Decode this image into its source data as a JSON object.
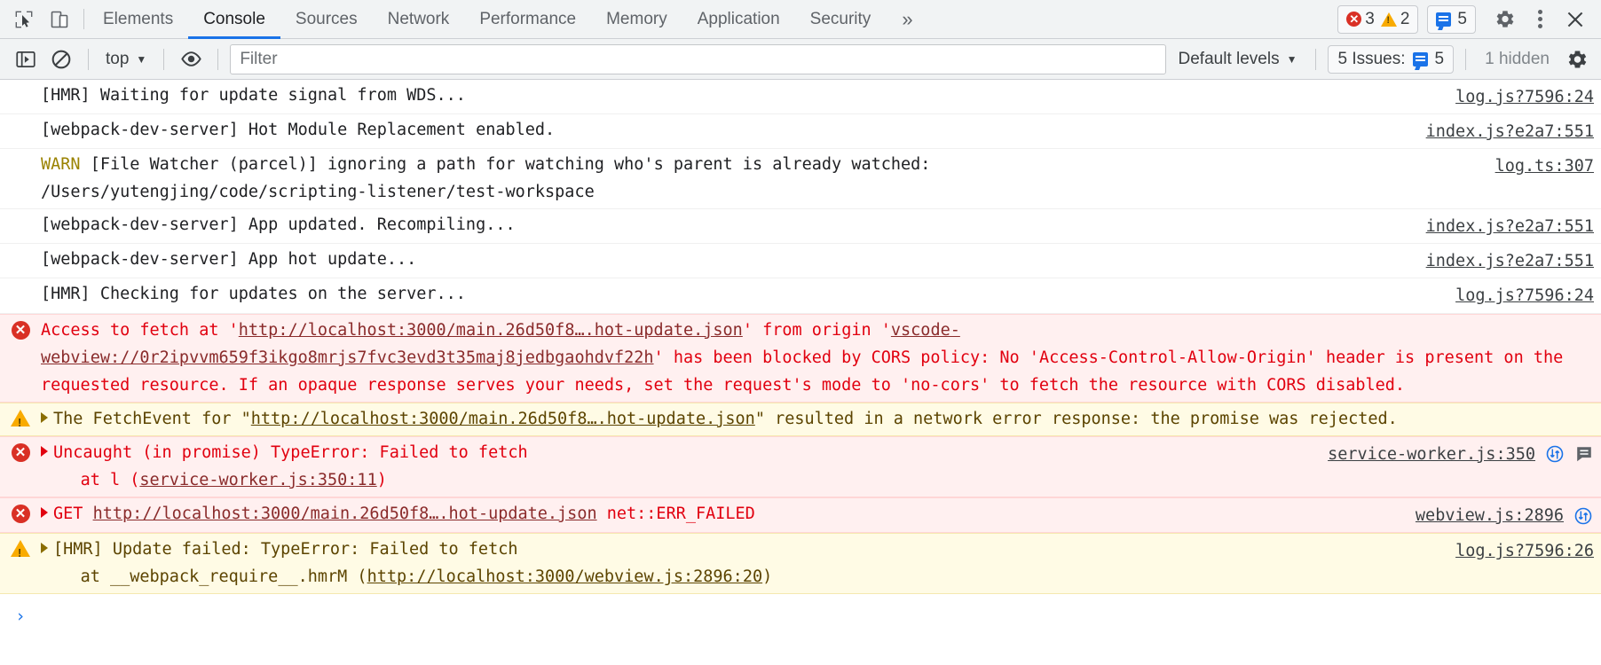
{
  "tabbar": {
    "left_icons": [
      {
        "name": "inspect-element-icon",
        "label": "Inspect element"
      },
      {
        "name": "device-toolbar-icon",
        "label": "Toggle device toolbar"
      }
    ],
    "tabs": [
      {
        "label": "Elements",
        "selected": false
      },
      {
        "label": "Console",
        "selected": true
      },
      {
        "label": "Sources",
        "selected": false
      },
      {
        "label": "Network",
        "selected": false
      },
      {
        "label": "Performance",
        "selected": false
      },
      {
        "label": "Memory",
        "selected": false
      },
      {
        "label": "Application",
        "selected": false
      },
      {
        "label": "Security",
        "selected": false
      }
    ],
    "more_tabs_glyph": "»",
    "error_count": "3",
    "warning_count": "2",
    "issue_count": "5",
    "settings_label": "Settings",
    "more_options_label": "More options",
    "close_label": "Close DevTools",
    "close_glyph": "✕"
  },
  "filterbar": {
    "sidebar_toggle_label": "Show console sidebar",
    "clear_console_label": "Clear console",
    "context_value": "top",
    "context_caret": "▼",
    "eye_label": "Create live expression",
    "filter_placeholder": "Filter",
    "filter_value": "",
    "levels_label": "Default levels",
    "levels_caret": "▼",
    "issues_label": "5 Issues:",
    "issues_count": "5",
    "hidden_label": "1 hidden",
    "settings_label": "Console settings"
  },
  "colors": {
    "accent": "#1a73e8",
    "error_text": "#e1000f",
    "error_bg": "#fff0f0",
    "warning_bg": "#fffbe5",
    "warning_text": "#5c4400",
    "warn_label": "#9a8200",
    "toolbar_bg": "#f1f3f4"
  },
  "console": {
    "messages": [
      {
        "level": "info",
        "expandable": false,
        "text": "[HMR] Waiting for update signal from WDS...",
        "source": "log.js?7596:24"
      },
      {
        "level": "info",
        "expandable": false,
        "text": "[webpack-dev-server] Hot Module Replacement enabled.",
        "source": "index.js?e2a7:551"
      },
      {
        "level": "info",
        "expandable": false,
        "warn_tag": "WARN",
        "text": " [File Watcher (parcel)] ignoring a path for watching who's parent is already watched:\n/Users/yutengjing/code/scripting-listener/test-workspace",
        "source": "log.ts:307"
      },
      {
        "level": "info",
        "expandable": false,
        "text": "[webpack-dev-server] App updated. Recompiling...",
        "source": "index.js?e2a7:551"
      },
      {
        "level": "info",
        "expandable": false,
        "text": "[webpack-dev-server] App hot update...",
        "source": "index.js?e2a7:551"
      },
      {
        "level": "info",
        "expandable": false,
        "text": "[HMR] Checking for updates on the server...",
        "source": "log.js?7596:24"
      },
      {
        "level": "error",
        "expandable": false,
        "segments": [
          {
            "t": "Access to fetch at '",
            "link": false
          },
          {
            "t": "http://localhost:3000/main.26d50f8….hot-update.json",
            "link": true
          },
          {
            "t": "' from origin '",
            "link": false
          },
          {
            "t": "vscode-webview://0r2ipvvm659f3ikgo8mrjs7fvc3evd3t35maj8jedbgaohdvf22h",
            "link": true
          },
          {
            "t": "' has been blocked by CORS policy: No 'Access-Control-Allow-Origin' header is present on the requested resource. If an opaque response serves your needs, set the request's mode to 'no-cors' to fetch the resource with CORS disabled.",
            "link": false
          }
        ],
        "source": ""
      },
      {
        "level": "warning",
        "expandable": true,
        "segments": [
          {
            "t": "The FetchEvent for \"",
            "link": false
          },
          {
            "t": "http://localhost:3000/main.26d50f8….hot-update.json",
            "link": true
          },
          {
            "t": "\" resulted in a network error response: the promise was rejected.",
            "link": false
          }
        ],
        "source": ""
      },
      {
        "level": "error",
        "expandable": true,
        "segments": [
          {
            "t": "Uncaught (in promise) TypeError: Failed to fetch\n    at l (",
            "link": false
          },
          {
            "t": "service-worker.js:350:11",
            "link": true
          },
          {
            "t": ")",
            "link": false
          }
        ],
        "source": "service-worker.js:350",
        "network_icon": true,
        "issue_icon": true
      },
      {
        "level": "error",
        "expandable": true,
        "segments": [
          {
            "t": "GET ",
            "link": false
          },
          {
            "t": "http://localhost:3000/main.26d50f8….hot-update.json",
            "link": true
          },
          {
            "t": " net::ERR_FAILED",
            "link": false
          }
        ],
        "source": "webview.js:2896",
        "network_icon": true,
        "issue_icon": false
      },
      {
        "level": "warning",
        "expandable": true,
        "segments": [
          {
            "t": "[HMR] Update failed: TypeError: Failed to fetch\n    at __webpack_require__.hmrM (",
            "link": false
          },
          {
            "t": "http://localhost:3000/webview.js:2896:20",
            "link": true
          },
          {
            "t": ")",
            "link": false
          }
        ],
        "source": "log.js?7596:26"
      }
    ],
    "prompt_glyph": "›",
    "prompt_value": ""
  }
}
